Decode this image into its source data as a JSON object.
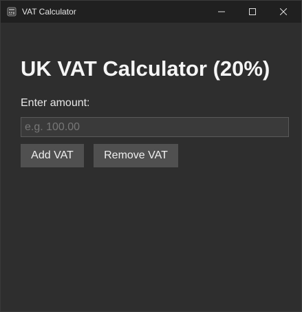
{
  "window": {
    "title": "VAT Calculator",
    "icon": "calculator-icon",
    "controls": [
      "minimize-icon",
      "maximize-icon",
      "close-icon"
    ]
  },
  "main": {
    "heading": "UK VAT Calculator (20%)",
    "amount_label": "Enter amount:",
    "amount_value": "",
    "amount_placeholder": "e.g. 100.00",
    "add_vat_label": "Add VAT",
    "remove_vat_label": "Remove VAT"
  },
  "colors": {
    "background": "#2e2e2e",
    "titlebar": "#202020",
    "button": "#505050",
    "input": "#3a3a3a",
    "text": "#f5f5f5"
  }
}
